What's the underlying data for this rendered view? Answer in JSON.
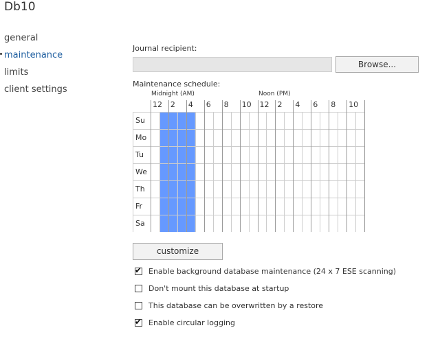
{
  "page": {
    "title": "Db10"
  },
  "nav": {
    "items": [
      {
        "label": "general",
        "active": false
      },
      {
        "label": "maintenance",
        "active": true
      },
      {
        "label": "limits",
        "active": false
      },
      {
        "label": "client settings",
        "active": false
      }
    ]
  },
  "journal": {
    "label": "Journal recipient:",
    "value": "",
    "browse_label": "Browse..."
  },
  "schedule": {
    "label": "Maintenance schedule:",
    "midnight_label": "Midnight (AM)",
    "noon_label": "Noon (PM)",
    "hour_labels": [
      "12",
      "2",
      "4",
      "6",
      "8",
      "10",
      "12",
      "2",
      "4",
      "6",
      "8",
      "10"
    ],
    "days": [
      "Su",
      "Mo",
      "Tu",
      "We",
      "Th",
      "Fr",
      "Sa"
    ],
    "slots_per_day": 24,
    "selected_slots": [
      1,
      2,
      3,
      4
    ],
    "selected_color": "#6699ff",
    "grid_line_color": "#cccccc",
    "customize_label": "customize"
  },
  "options": [
    {
      "label": "Enable background database maintenance (24 x 7 ESE scanning)",
      "checked": true,
      "check_glyph": "✔"
    },
    {
      "label": "Don't mount this database at startup",
      "checked": false,
      "check_glyph": ""
    },
    {
      "label": "This database can be overwritten by a restore",
      "checked": false,
      "check_glyph": ""
    },
    {
      "label": "Enable circular logging",
      "checked": true,
      "check_glyph": "✔"
    }
  ]
}
